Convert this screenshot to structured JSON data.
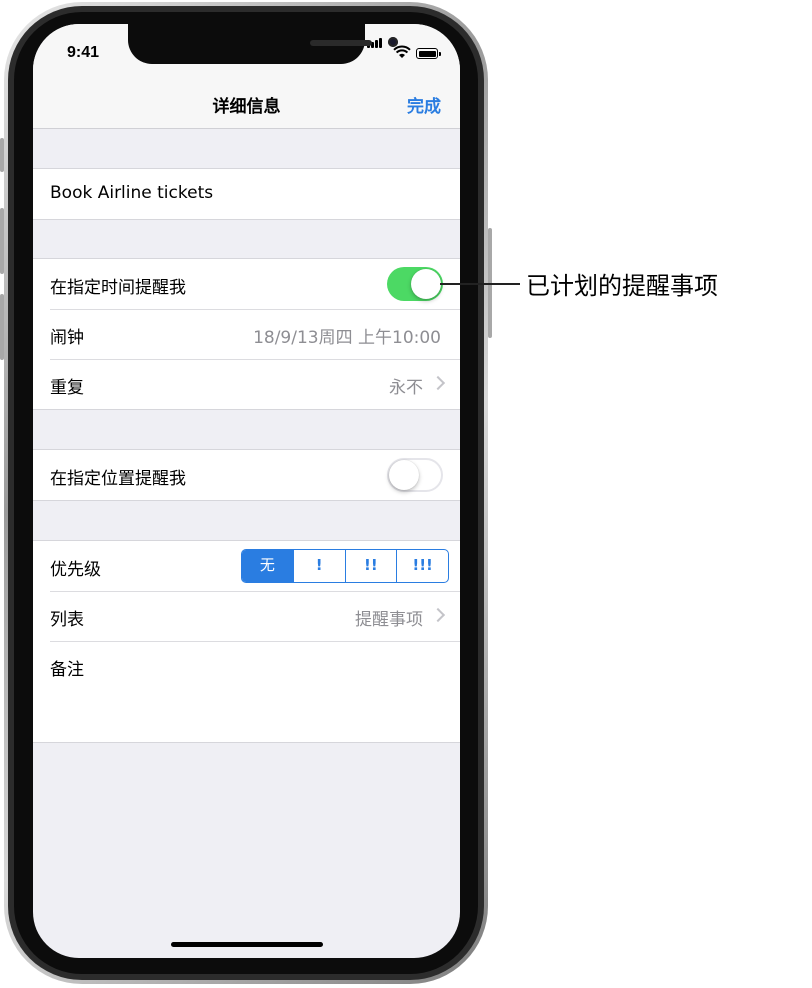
{
  "status_bar": {
    "time": "9:41"
  },
  "nav": {
    "title": "详细信息",
    "done_label": "完成"
  },
  "task": {
    "title": "Book Airline tickets"
  },
  "remind_time": {
    "label": "在指定时间提醒我",
    "enabled": true
  },
  "alarm": {
    "label": "闹钟",
    "value": "18/9/13周四 上午10:00"
  },
  "repeat": {
    "label": "重复",
    "value": "永不"
  },
  "remind_location": {
    "label": "在指定位置提醒我",
    "enabled": false
  },
  "priority": {
    "label": "优先级",
    "options": [
      "无",
      "!",
      "!!",
      "!!!"
    ],
    "selected": "无"
  },
  "list": {
    "label": "列表",
    "value": "提醒事项"
  },
  "notes": {
    "label": "备注"
  },
  "callout": {
    "text": "已计划的提醒事项"
  },
  "colors": {
    "accent": "#2a7de1",
    "toggle_on": "#4cd964",
    "background": "#efeff4"
  }
}
